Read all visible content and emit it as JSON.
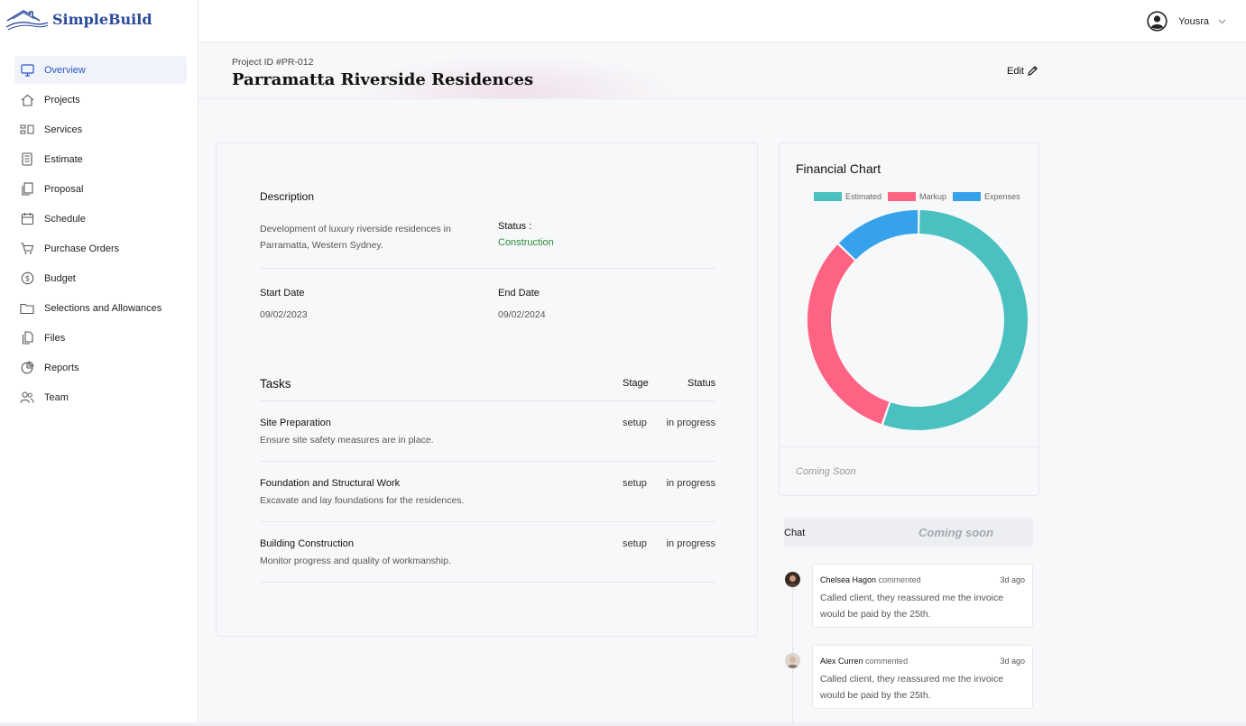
{
  "app": {
    "name": "SimpleBuild"
  },
  "sidebar": {
    "items": [
      {
        "label": "Overview",
        "icon": "monitor-icon",
        "active": true
      },
      {
        "label": "Projects",
        "icon": "home-icon"
      },
      {
        "label": "Services",
        "icon": "services-icon"
      },
      {
        "label": "Estimate",
        "icon": "calculator-icon"
      },
      {
        "label": "Proposal",
        "icon": "documents-icon"
      },
      {
        "label": "Schedule",
        "icon": "calendar-icon"
      },
      {
        "label": "Purchase Orders",
        "icon": "cart-icon"
      },
      {
        "label": "Budget",
        "icon": "dollar-icon"
      },
      {
        "label": "Selections and Allowances",
        "icon": "folder-icon"
      },
      {
        "label": "Files",
        "icon": "files-icon"
      },
      {
        "label": "Reports",
        "icon": "pie-chart-icon"
      },
      {
        "label": "Team",
        "icon": "team-icon"
      }
    ]
  },
  "topbar": {
    "user_name": "Yousra"
  },
  "project": {
    "id_label": "Project ID #PR-012",
    "title": "Parramatta Riverside Residences",
    "edit_label": "Edit",
    "description_heading": "Description",
    "description": "Development of luxury riverside residences in Parramatta, Western Sydney.",
    "status_label": "Status :",
    "status_value": "Construction",
    "start_label": "Start Date",
    "start_value": "09/02/2023",
    "end_label": "End Date",
    "end_value": "09/02/2024"
  },
  "tasks": {
    "title": "Tasks",
    "col_stage": "Stage",
    "col_status": "Status",
    "rows": [
      {
        "name": "Site Preparation",
        "desc": "Ensure site safety measures are in place.",
        "stage": "setup",
        "status": "in progress"
      },
      {
        "name": "Foundation and Structural Work",
        "desc": "Excavate and lay foundations for the residences.",
        "stage": "setup",
        "status": "in progress"
      },
      {
        "name": "Building Construction",
        "desc": "Monitor progress and quality of workmanship.",
        "stage": "setup",
        "status": "in progress"
      }
    ]
  },
  "financial": {
    "title": "Financial Chart",
    "coming_soon": "Coming Soon"
  },
  "chart_data": {
    "type": "pie",
    "variant": "doughnut",
    "categories": [
      "Estimated",
      "Markup",
      "Expenses"
    ],
    "values": [
      55,
      32,
      13
    ],
    "colors": [
      "#4bc0c0",
      "#ff6384",
      "#36a2eb"
    ],
    "legend_position": "top"
  },
  "chat": {
    "label": "Chat",
    "coming_soon": "Coming soon",
    "comments": [
      {
        "author": "Chelsea Hagon",
        "verb": "commented",
        "time": "3d ago",
        "body": "Called client, they reassured me the invoice would be paid by the 25th."
      },
      {
        "author": "Alex Curren",
        "verb": "commented",
        "time": "3d ago",
        "body": "Called client, they reassured me the invoice would be paid by the 25th."
      }
    ]
  }
}
